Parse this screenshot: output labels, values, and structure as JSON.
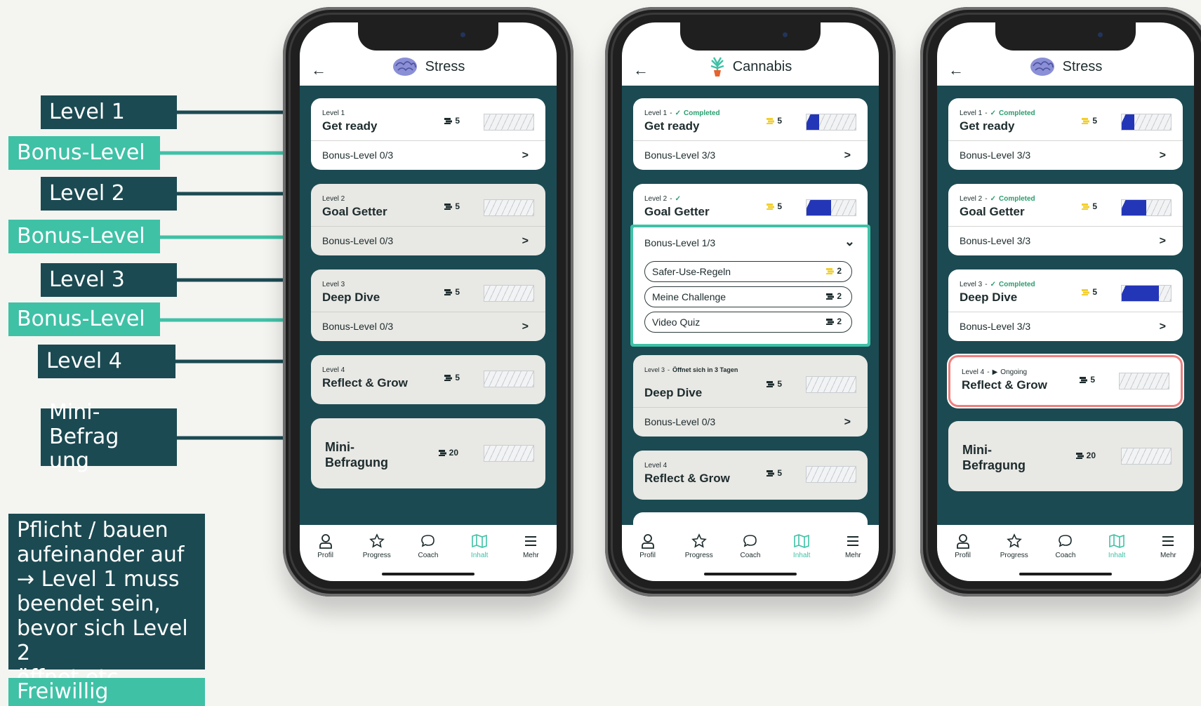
{
  "annotations": {
    "level1": "Level 1",
    "bonus1": "Bonus-Level",
    "level2": "Level 2",
    "bonus2": "Bonus-Level",
    "level3": "Level 3",
    "bonus3": "Bonus-Level",
    "level4": "Level 4",
    "mini": "Mini-Befrag ung",
    "mini_line1": "Mini-Befrag",
    "mini_line2": "ung",
    "pflicht_lines": [
      "Pflicht / bauen",
      "aufeinander auf",
      "→ Level 1 muss",
      "beendet sein,",
      "bevor sich Level 2",
      "öffnet etc."
    ],
    "freiwillig": "Freiwillig"
  },
  "colors": {
    "dark": "#1b4a52",
    "teal": "#3fc1a6",
    "progress": "#2436b8",
    "ongoing": "#ef7f7f"
  },
  "phone1": {
    "title": "Stress",
    "title_icon": "brain-icon",
    "levels": [
      {
        "level": "Level 1",
        "name": "Get ready",
        "coins": "5",
        "bonus": "Bonus-Level 0/3",
        "progress": 0
      },
      {
        "level": "Level 2",
        "name": "Goal Getter",
        "coins": "5",
        "bonus": "Bonus-Level 0/3",
        "progress": 0
      },
      {
        "level": "Level 3",
        "name": "Deep Dive",
        "coins": "5",
        "bonus": "Bonus-Level 0/3",
        "progress": 0
      },
      {
        "level": "Level 4",
        "name": "Reflect & Grow",
        "coins": "5",
        "progress": 0
      }
    ],
    "mini": {
      "line1": "Mini-",
      "line2": "Befragung",
      "coins": "20"
    }
  },
  "phone2": {
    "title": "Cannabis",
    "title_icon": "plant-icon",
    "level1": {
      "level": "Level 1",
      "status": "Completed",
      "name": "Get ready",
      "coins": "5",
      "bonus": "Bonus-Level 3/3",
      "progress": 0.25
    },
    "level2": {
      "level": "Level 2",
      "name": "Goal Getter",
      "coins": "5",
      "progress": 0.5
    },
    "expanded": {
      "header": "Bonus-Level 1/3",
      "items": [
        {
          "label": "Safer-Use-Regeln",
          "coins": "2"
        },
        {
          "label": "Meine Challenge",
          "coins": "2"
        },
        {
          "label": "Video Quiz",
          "coins": "2"
        }
      ]
    },
    "level3": {
      "level": "Level 3",
      "status": "Öffnet sich in 3 Tagen",
      "name": "Deep Dive",
      "coins": "5",
      "bonus": "Bonus-Level 0/3",
      "progress": 0
    },
    "level4": {
      "level": "Level 4",
      "name": "Reflect & Grow",
      "coins": "5",
      "progress": 0
    }
  },
  "phone3": {
    "title": "Stress",
    "title_icon": "brain-icon",
    "levels": [
      {
        "level": "Level 1",
        "status": "Completed",
        "name": "Get ready",
        "coins": "5",
        "bonus": "Bonus-Level 3/3",
        "progress": 0.25
      },
      {
        "level": "Level 2",
        "status": "Completed",
        "name": "Goal Getter",
        "coins": "5",
        "bonus": "Bonus-Level 3/3",
        "progress": 0.5
      },
      {
        "level": "Level 3",
        "status": "Completed",
        "name": "Deep Dive",
        "coins": "5",
        "bonus": "Bonus-Level 3/3",
        "progress": 0.75
      }
    ],
    "level4": {
      "level": "Level 4",
      "status": "Ongoing",
      "name": "Reflect & Grow",
      "coins": "5",
      "progress": 0
    },
    "mini": {
      "line1": "Mini-",
      "line2": "Befragung",
      "coins": "20"
    }
  },
  "nav": [
    {
      "label": "Profil",
      "icon": "profile-icon"
    },
    {
      "label": "Progress",
      "icon": "star-icon"
    },
    {
      "label": "Coach",
      "icon": "chat-icon"
    },
    {
      "label": "Inhalt",
      "icon": "map-icon"
    },
    {
      "label": "Mehr",
      "icon": "menu-icon"
    }
  ]
}
